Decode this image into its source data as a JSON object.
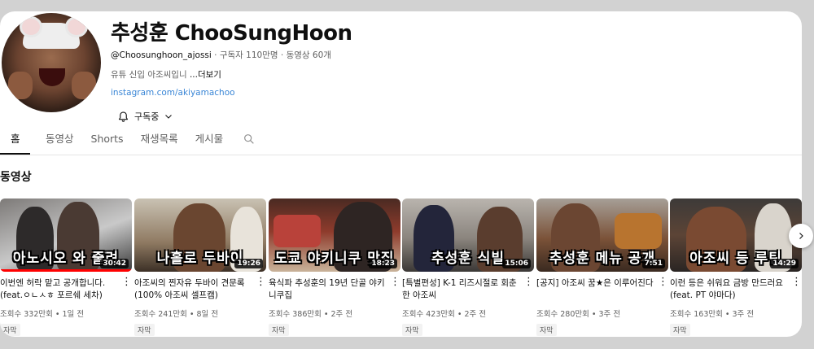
{
  "channel": {
    "name": "추성훈 ChooSungHoon",
    "handle": "@Choosunghoon_ajossi",
    "subscribers": "구독자 110만명",
    "video_count": "동영상 60개",
    "separator": "·",
    "description": "유튜 신입 아조씨입니",
    "more_label": "...더보기",
    "link": "instagram.com/akiyamachoo",
    "subscribe_label": "구독중"
  },
  "tabs": [
    {
      "label": "홈"
    },
    {
      "label": "동영상"
    },
    {
      "label": "Shorts"
    },
    {
      "label": "재생목록"
    },
    {
      "label": "게시물"
    }
  ],
  "section": {
    "title": "동영상"
  },
  "videos": [
    {
      "overlay": "아노시오 와 줄려",
      "duration": "30:42",
      "title": "이번엔 허락 맡고 공개합니다. (feat.ㅇㄴㅅㅎ 포르쉐 세차)",
      "views": "조회수 332만회",
      "age": "1일 전",
      "badge": "자막",
      "watched": 1.0
    },
    {
      "overlay": "나홀로 두바이",
      "duration": "19:26",
      "title": "아조씨의 찐자유 두바이 견문록 (100% 아조씨 셀프캠)",
      "views": "조회수 241만회",
      "age": "8일 전",
      "badge": "자막",
      "watched": 0
    },
    {
      "overlay": "도쿄 야키니쿠 맛집",
      "duration": "18:23",
      "title": "육식파 추성훈의 19년 단골 야키니쿠집",
      "views": "조회수 386만회",
      "age": "2주 전",
      "badge": "자막",
      "watched": 0
    },
    {
      "overlay": "추성훈 식빌",
      "duration": "15:06",
      "title": "[특별편성] K-1 리즈시절로 회춘한 아조씨",
      "views": "조회수 423만회",
      "age": "2주 전",
      "badge": "자막",
      "watched": 0
    },
    {
      "overlay": "추성훈 메뉴 공개",
      "duration": "7:51",
      "title": "[공지] 아조씨 꿈★은 이루어진다",
      "views": "조회수 280만회",
      "age": "3주 전",
      "badge": "자막",
      "watched": 0
    },
    {
      "overlay": "아조씨 등 루틴",
      "duration": "14:29",
      "title": "이런 등은 쉬워요 금방 만드러요 (feat. PT 야마다)",
      "views": "조회수 163만회",
      "age": "3주 전",
      "badge": "자막",
      "watched": 0
    }
  ],
  "icons": {
    "bell": "bell-icon",
    "chevron": "chevron-down-icon",
    "search": "search-icon",
    "more": "more-vert-icon",
    "next": "chevron-right-icon"
  },
  "colors": {
    "link": "#3a86d6",
    "progress": "#ff0000",
    "text_secondary": "#606060"
  }
}
